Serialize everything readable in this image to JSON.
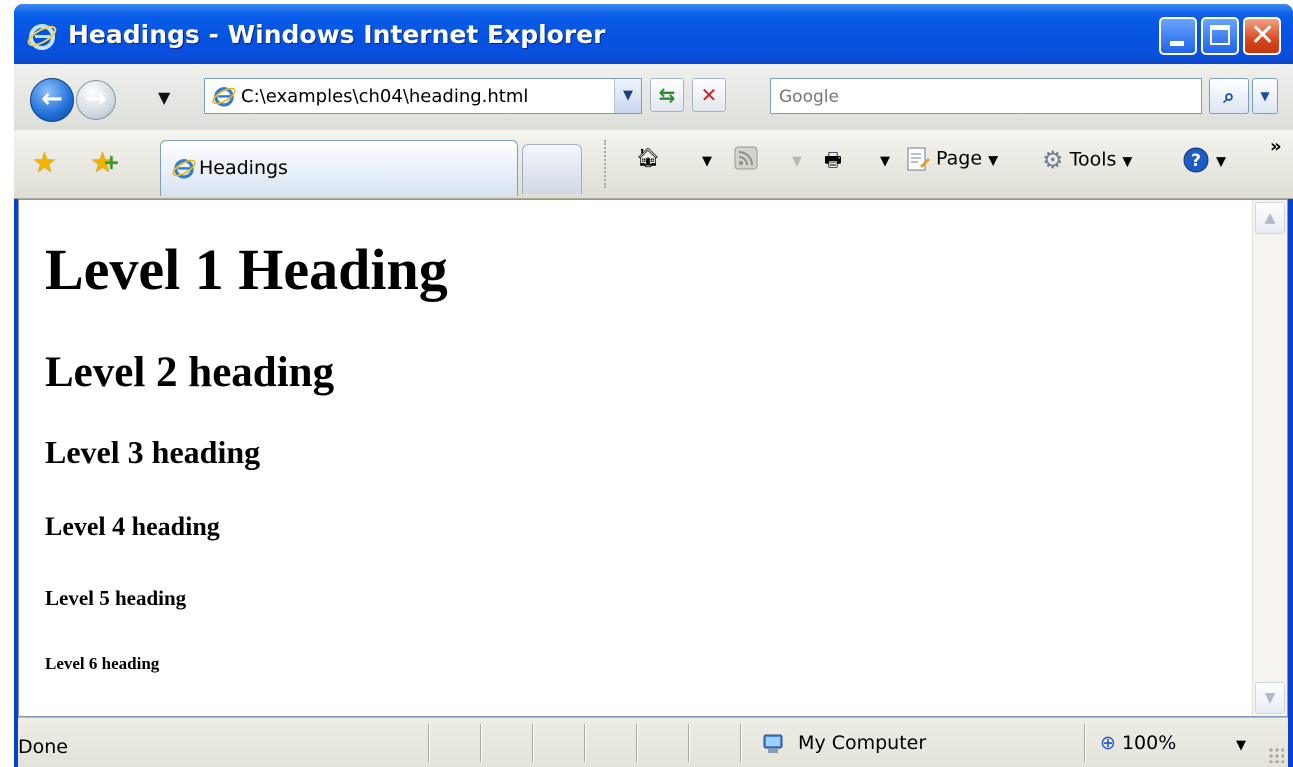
{
  "window": {
    "title": "Headings - Windows Internet Explorer"
  },
  "navigation": {
    "address_url": "C:\\examples\\ch04\\heading.html",
    "search_placeholder": "Google"
  },
  "command_bar": {
    "tab_label": "Headings",
    "page_label": "Page",
    "tools_label": "Tools",
    "more_glyph": "»"
  },
  "content": {
    "h1": "Level 1 Heading",
    "h2": "Level 2 heading",
    "h3": "Level 3 heading",
    "h4": "Level 4 heading",
    "h5": "Level 5 heading",
    "h6": "Level 6 heading"
  },
  "status_bar": {
    "status": "Done",
    "zone": "My Computer",
    "zoom": "100%"
  },
  "icons": [
    "ie-logo-icon",
    "back-arrow-icon",
    "forward-arrow-icon",
    "refresh-icon",
    "stop-icon",
    "search-icon",
    "favorites-star-icon",
    "add-favorites-icon",
    "home-icon",
    "feeds-icon",
    "print-icon",
    "page-icon",
    "tools-gear-icon",
    "help-icon",
    "computer-icon",
    "zoom-icon"
  ],
  "colors": {
    "titlebar": "#0553e1",
    "close_button": "#d8481f",
    "accent_blue": "#1e6fd6"
  }
}
